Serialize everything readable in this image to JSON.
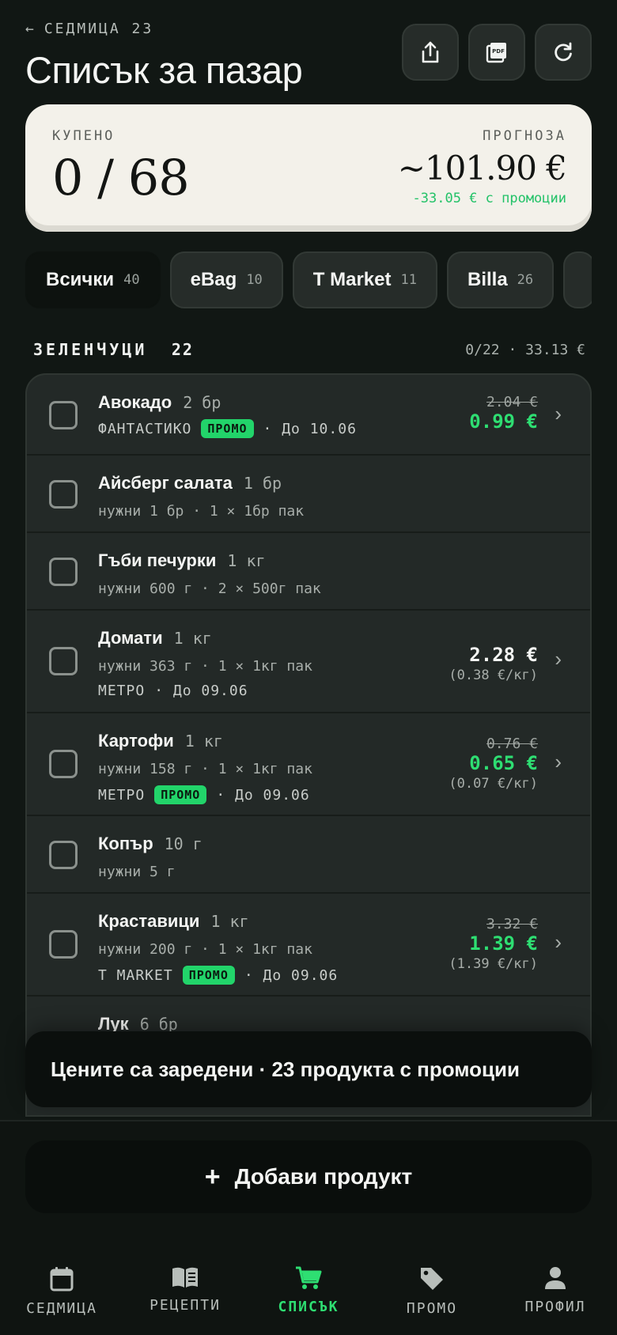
{
  "header": {
    "back_label": "СЕДМИЦА 23",
    "title": "Списък за пазар",
    "actions": [
      {
        "icon": "share-icon"
      },
      {
        "icon": "pdf-icon"
      },
      {
        "icon": "refresh-icon"
      }
    ]
  },
  "summary": {
    "bought_label": "КУПЕНО",
    "bought_value": "0 / 68",
    "forecast_label": "ПРОГНОЗА",
    "forecast_value": "~101.90 €",
    "promo_savings": "-33.05 € с промоции"
  },
  "filters": [
    {
      "label": "Всички",
      "count": "40",
      "active": true
    },
    {
      "label": "eBag",
      "count": "10",
      "active": false
    },
    {
      "label": "T Market",
      "count": "11",
      "active": false
    },
    {
      "label": "Billa",
      "count": "26",
      "active": false
    }
  ],
  "section": {
    "title": "ЗЕЛЕНЧУЦИ",
    "count": "22",
    "meta": "0/22 · 33.13 €"
  },
  "items": [
    {
      "name": "Авокадо",
      "qty": "2 бр",
      "store": "ФАНТАСТИКО",
      "promo": "ПРОМО",
      "until": "· До 10.06",
      "old_price": "2.04 €",
      "new_price": "0.99 €"
    },
    {
      "name": "Айсберг салата",
      "qty": "1 бр",
      "detail": "нужни 1 бр · 1 × 1бр пак"
    },
    {
      "name": "Гъби печурки",
      "qty": "1 кг",
      "detail": "нужни 600 г · 2 × 500г пак"
    },
    {
      "name": "Домати",
      "qty": "1 кг",
      "detail": "нужни 363 г · 1 × 1кг пак",
      "store": "МЕТРО",
      "until": "· До 09.06",
      "price": "2.28 €",
      "unit_price": "(0.38 €/кг)"
    },
    {
      "name": "Картофи",
      "qty": "1 кг",
      "detail": "нужни 158 г · 1 × 1кг пак",
      "store": "МЕТРО",
      "promo": "ПРОМО",
      "until": "· До 09.06",
      "old_price": "0.76 €",
      "new_price": "0.65 €",
      "unit_price": "(0.07 €/кг)"
    },
    {
      "name": "Копър",
      "qty": "10 г",
      "detail": "нужни 5 г"
    },
    {
      "name": "Краставици",
      "qty": "1 кг",
      "detail": "нужни 200 г · 1 × 1кг пак",
      "store": "T MARKET",
      "promo": "ПРОМО",
      "until": "· До 09.06",
      "old_price": "3.32 €",
      "new_price": "1.39 €",
      "unit_price": "(1.39 €/кг)"
    },
    {
      "name": "Лук",
      "qty": "6 бр"
    }
  ],
  "toast": {
    "text": "Цените са заредени · 23 продукта с промоции"
  },
  "add_button": {
    "label": "Добави продукт"
  },
  "tabs": [
    {
      "label": "СЕДМИЦА",
      "icon": "calendar-icon"
    },
    {
      "label": "РЕЦЕПТИ",
      "icon": "book-icon"
    },
    {
      "label": "СПИСЪК",
      "icon": "cart-icon",
      "active": true
    },
    {
      "label": "ПРОМО",
      "icon": "tag-icon"
    },
    {
      "label": "ПРОФИЛ",
      "icon": "person-icon"
    }
  ],
  "colors": {
    "accent": "#2ede72",
    "promo_badge": "#22d46a",
    "background": "#111714",
    "card": "#f3f1ea"
  }
}
